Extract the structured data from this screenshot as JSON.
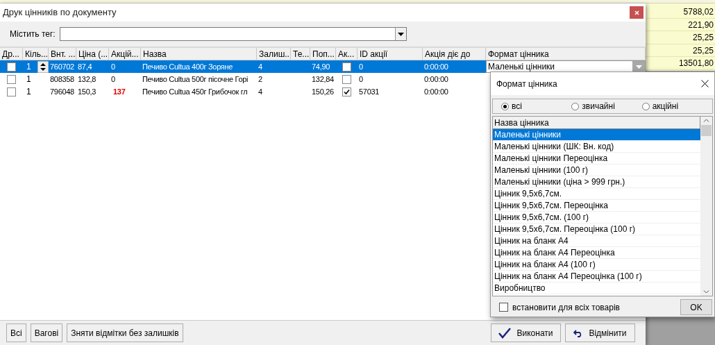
{
  "background": {
    "values": [
      "5788,02",
      "221,90",
      "25,25",
      "25,25",
      "13501,80"
    ]
  },
  "window": {
    "title": "Друк цінників по документу"
  },
  "filter": {
    "label": "Містить тег:"
  },
  "table": {
    "columns": [
      "Др...",
      "Кіль...",
      "Внт. ...",
      "Ціна (...",
      "Акцій...",
      "Назва",
      "Залиш...",
      "Те...",
      "Поп...",
      "Ак...",
      "ID акції",
      "Акція діє до",
      "Формат цінника"
    ],
    "rows": [
      {
        "selected": true,
        "print": false,
        "qty": "1",
        "code": "760702",
        "price": "87,4",
        "promo_price": "0",
        "promo_highlight": false,
        "name": "Печиво Cultua 400г Зоряне",
        "stock": "4",
        "prev_price": "74,90",
        "promo": false,
        "promo_id": "0",
        "promo_until": "0:00:00",
        "format": "Маленькі цінники"
      },
      {
        "selected": false,
        "print": false,
        "qty": "1",
        "code": "808358",
        "price": "132,8",
        "promo_price": "0",
        "promo_highlight": false,
        "name": "Печиво Cultua 500г пісочне Горі",
        "stock": "2",
        "prev_price": "132,84",
        "promo": false,
        "promo_id": "0",
        "promo_until": "0:00:00"
      },
      {
        "selected": false,
        "print": false,
        "qty": "1",
        "code": "796048",
        "price": "150,3",
        "promo_price": "137",
        "promo_highlight": true,
        "name": "Печиво Cultua 450г Грибочок гл",
        "stock": "4",
        "prev_price": "150,26",
        "promo": true,
        "promo_id": "57031",
        "promo_until": "0:00:00"
      }
    ]
  },
  "buttons_left": [
    "Всі",
    "Вагові",
    "Зняти відмітки без залишків"
  ],
  "buttons_right": [
    {
      "kind": "ok",
      "label": "Виконати"
    },
    {
      "kind": "cancel",
      "label": "Відмінити"
    }
  ],
  "popup": {
    "title": "Формат цінника",
    "radios": [
      {
        "label": "всі",
        "selected": true
      },
      {
        "label": "звичайні",
        "selected": false
      },
      {
        "label": "акційні",
        "selected": false
      }
    ],
    "list_header": "Назва цінника",
    "items": [
      {
        "label": "Маленькі цінники",
        "selected": true
      },
      {
        "label": "Маленькі цінники (ШК: Вн. код)",
        "selected": false
      },
      {
        "label": "Маленькі цінники Переоцінка",
        "selected": false
      },
      {
        "label": "Маленькі цінники (100 г)",
        "selected": false
      },
      {
        "label": "Маленькі цінники (ціна > 999 грн.)",
        "selected": false
      },
      {
        "label": "Цінник 9,5х6,7см.",
        "selected": false
      },
      {
        "label": "Цінник 9,5х6,7см. Переоцінка",
        "selected": false
      },
      {
        "label": "Цінник 9,5х6,7см. (100 г)",
        "selected": false
      },
      {
        "label": "Цінник 9,5х6,7см. Переоцінка (100 г)",
        "selected": false
      },
      {
        "label": "Цінник на бланк А4",
        "selected": false
      },
      {
        "label": "Цінник на бланк А4 Переоцінка",
        "selected": false
      },
      {
        "label": "Цінник на бланк А4 (100 г)",
        "selected": false
      },
      {
        "label": "Цінник на бланк А4 Переоцінка (100 г)",
        "selected": false
      },
      {
        "label": "Виробництво",
        "selected": false
      }
    ],
    "apply_all": {
      "label": "встановити для всіх товарів",
      "checked": false
    },
    "ok": "OK"
  }
}
